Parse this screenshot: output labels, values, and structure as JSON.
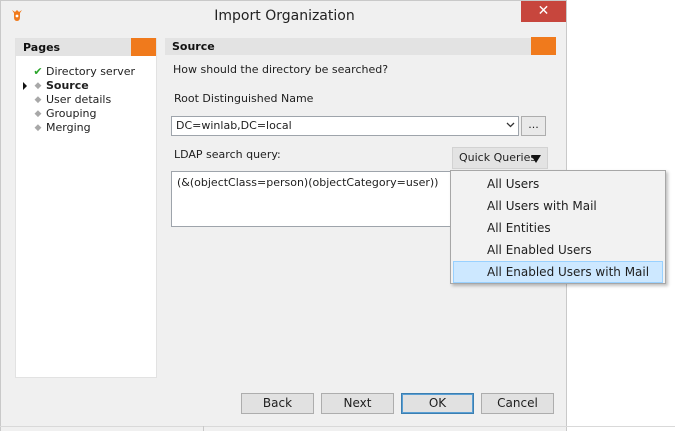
{
  "window": {
    "title": "Import Organization",
    "close_glyph": "✕"
  },
  "pages_panel": {
    "header": "Pages",
    "current_index": 1,
    "items": [
      {
        "label": "Directory server",
        "state": "done"
      },
      {
        "label": "Source",
        "state": "current"
      },
      {
        "label": "User details",
        "state": "pending"
      },
      {
        "label": "Grouping",
        "state": "pending"
      },
      {
        "label": "Merging",
        "state": "pending"
      }
    ],
    "check_glyph": "✔",
    "dot_glyph": "◆"
  },
  "source_panel": {
    "header": "Source",
    "question": "How should the directory be searched?",
    "rdn_label": "Root Distinguished Name",
    "rdn_value": "DC=winlab,DC=local",
    "browse_label": "...",
    "ldap_label": "LDAP search query:",
    "quick_queries_label": "Quick Queries",
    "query_value": "(&(objectClass=person)(objectCategory=user))"
  },
  "quick_queries_menu": {
    "items": [
      "All Users",
      "All Users with Mail",
      "All Entities",
      "All Enabled Users",
      "All Enabled Users with Mail"
    ],
    "highlighted_index": 4
  },
  "buttons": {
    "back": "Back",
    "next": "Next",
    "ok": "OK",
    "cancel": "Cancel"
  },
  "colors": {
    "accent": "#f07a1c",
    "highlight": "#cde8ff",
    "close": "#c7463d",
    "check": "#2aa52a"
  }
}
